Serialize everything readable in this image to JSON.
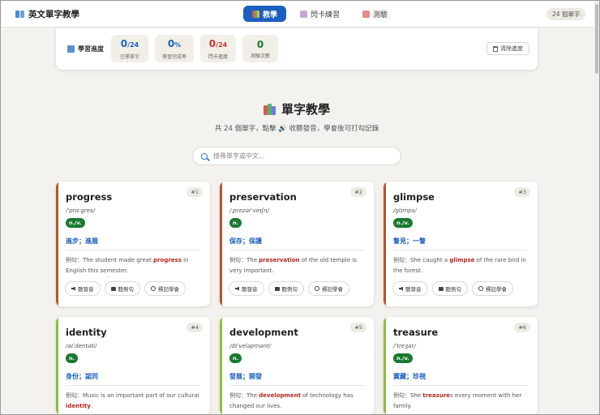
{
  "header": {
    "app_title": "英文單字教學",
    "tabs": [
      {
        "label": "教學",
        "icon": "books-icon",
        "active": true
      },
      {
        "label": "閃卡練習",
        "icon": "flashcard-icon",
        "active": false
      },
      {
        "label": "測驗",
        "icon": "quiz-icon",
        "active": false
      }
    ],
    "word_count": "24 個單字"
  },
  "progress": {
    "title": "學習進度",
    "stats": [
      {
        "value": "0",
        "suffix": "/24",
        "label": "已學單字",
        "color": "#1d5fbf"
      },
      {
        "value": "0",
        "suffix": "%",
        "label": "學習完成率",
        "color": "#1d5fbf"
      },
      {
        "value": "0",
        "suffix": "/24",
        "label": "閃卡進度",
        "color": "#c0392b"
      },
      {
        "value": "0",
        "suffix": "",
        "label": "測驗次數",
        "color": "#187a30"
      }
    ],
    "clear_label": "清除進度"
  },
  "section": {
    "title": "單字教學",
    "subtitle": "共 24 個單字，點擊 🔊 收聽發音，學會後可打勾記錄",
    "search_placeholder": "搜尋單字或中文..."
  },
  "cards": [
    {
      "num": "#1",
      "word": "progress",
      "phonetic": "/ˈprɑːgres/",
      "pos": "n./v.",
      "meaning": "進步；進展",
      "ex_pre": "例句：The student made great ",
      "ex_hl": "progress",
      "ex_post": " in English this semester.",
      "accent": "#b5562a"
    },
    {
      "num": "#2",
      "word": "preservation",
      "phonetic": "/ˌprezərˈveɪʃn/",
      "pos": "n.",
      "meaning": "保存；保護",
      "ex_pre": "例句：The ",
      "ex_hl": "preservation",
      "ex_post": " of the old temple is very important.",
      "accent": "#b5562a"
    },
    {
      "num": "#3",
      "word": "glimpse",
      "phonetic": "/glɪmps/",
      "pos": "n./v.",
      "meaning": "瞥見；一瞥",
      "ex_pre": "例句：She caught a ",
      "ex_hl": "glimpse",
      "ex_post": " of the rare bird in the forest.",
      "accent": "#b5562a"
    },
    {
      "num": "#4",
      "word": "identity",
      "phonetic": "/aɪˈdentəti/",
      "pos": "n.",
      "meaning": "身份；認同",
      "ex_pre": "例句：Music is an important part of our cultural ",
      "ex_hl": "identity",
      "ex_post": ".",
      "accent": "#8cbf3a"
    },
    {
      "num": "#5",
      "word": "development",
      "phonetic": "/dɪˈveləpmənt/",
      "pos": "n.",
      "meaning": "發展；開發",
      "ex_pre": "例句：The ",
      "ex_hl": "development",
      "ex_post": " of technology has changed our lives.",
      "accent": "#8cbf3a"
    },
    {
      "num": "#6",
      "word": "treasure",
      "phonetic": "/ˈtreʒər/",
      "pos": "n./v.",
      "meaning": "寶藏；珍視",
      "ex_pre": "例句：She ",
      "ex_hl": "treasure",
      "ex_post": "s every moment with her family.",
      "accent": "#8cbf3a"
    }
  ],
  "card_actions": {
    "listen_word": "聽發音",
    "listen_sentence": "聽例句",
    "mark_learned": "標記學會"
  }
}
